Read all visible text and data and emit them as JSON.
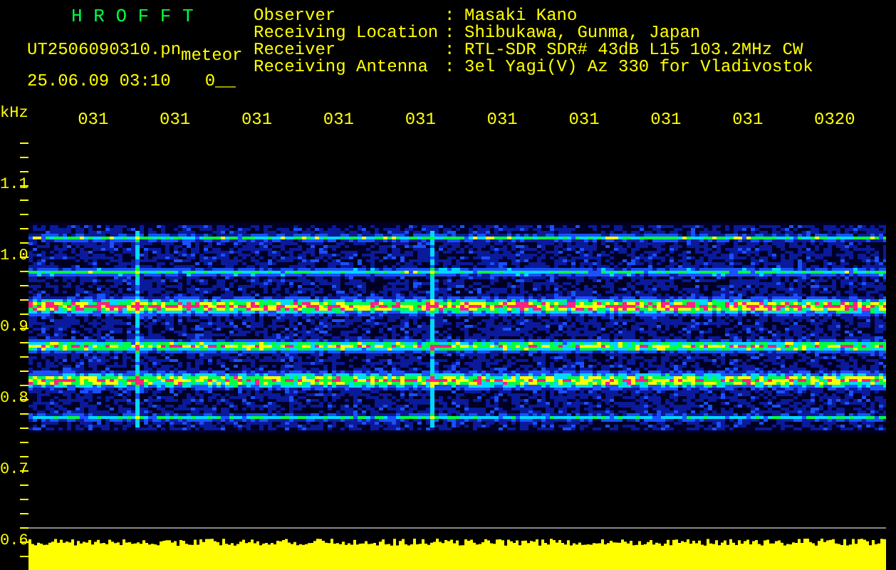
{
  "title": "H R O F F T",
  "file": "UT2506090310.pn",
  "mode": "meteor",
  "timestamp": "25.06.09 03:10",
  "counter": "0__",
  "info": [
    {
      "label": "Observer",
      "separator": ":",
      "value": "Masaki Kano"
    },
    {
      "label": "Receiving Location",
      "separator": ":",
      "value": "Shibukawa, Gunma, Japan"
    },
    {
      "label": "Receiver",
      "separator": ":",
      "value": "RTL-SDR SDR# 43dB L15 103.2MHz CW"
    },
    {
      "label": "Receiving Antenna",
      "separator": ":",
      "value": "3el Yagi(V) Az 330 for Vladivostok"
    }
  ],
  "unit": "kHz",
  "time_labels": [
    "031",
    "031",
    "031",
    "031",
    "031",
    "031",
    "031",
    "031",
    "031",
    "0320"
  ],
  "y_labels": [
    "1.1",
    "1.0",
    "0.9",
    "0.8",
    "0.7",
    "0.6"
  ]
}
